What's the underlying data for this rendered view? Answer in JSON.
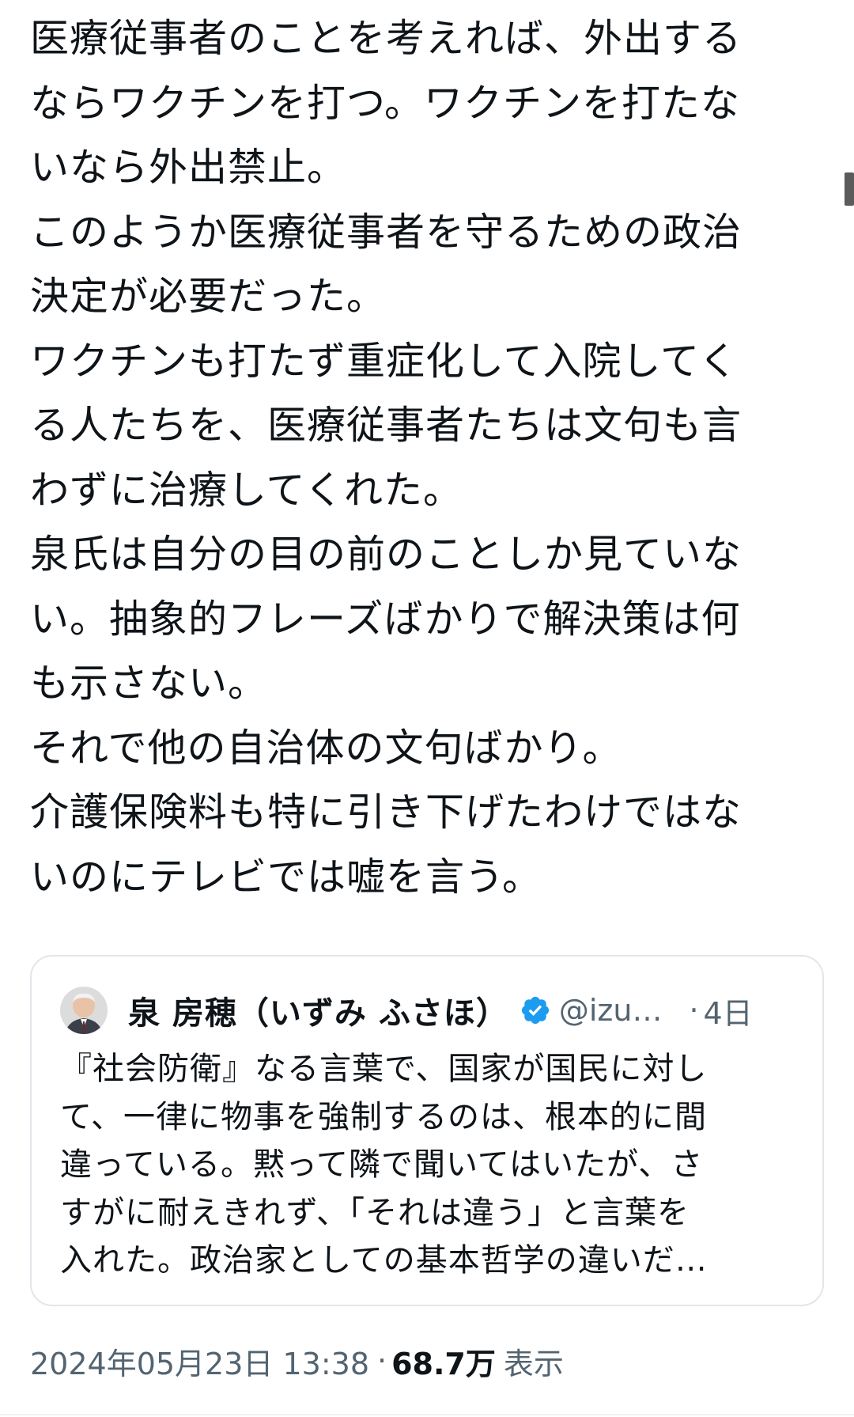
{
  "tweet": {
    "lines": [
      "医療従事者のことを考えれば、外出する",
      "ならワクチンを打つ。ワクチンを打たな",
      "いなら外出禁止。",
      "このようか医療従事者を守るための政治",
      "決定が必要だった。",
      "ワクチンも打たず重症化して入院してく",
      "る人たちを、医療従事者たちは文句も言",
      "わずに治療してくれた。",
      "泉氏は自分の目の前のことしか見ていな",
      "い。抽象的フレーズばかりで解決策は何",
      "も示さない。",
      "それで他の自治体の文句ばかり。",
      "介護保険料も特に引き下げたわけではな",
      "いのにテレビでは嘘を言う。"
    ]
  },
  "quote": {
    "name": "泉 房穂（いずみ ふさほ）",
    "handle": "@izu…",
    "separator": "·",
    "time": "4日",
    "verified_color": "#1d9bf0",
    "lines": [
      "『社会防衛』なる言葉で、国家が国民に対し",
      "て、一律に物事を強制するのは、根本的に間",
      "違っている。黙って隣で聞いてはいたが、さ",
      "すがに耐えきれず、「それは違う」と言葉を",
      "入れた。政治家としての基本哲学の違いだ…"
    ]
  },
  "meta": {
    "timestamp": "2024年05月23日 13:38",
    "separator": "·",
    "views": "68.7万",
    "views_label": "表示"
  },
  "colors": {
    "text": "#0f1419",
    "secondary": "#536471",
    "border": "#e1e6ea"
  }
}
